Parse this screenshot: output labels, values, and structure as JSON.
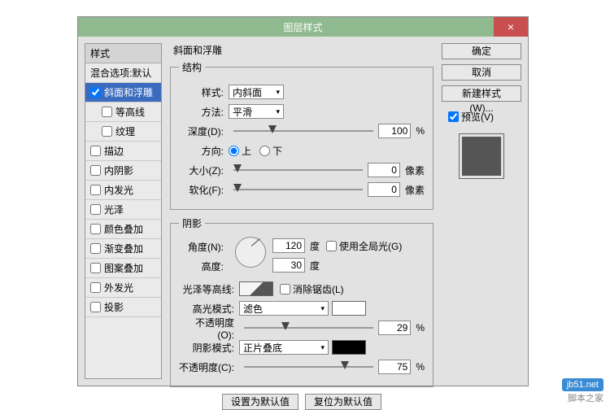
{
  "window": {
    "title": "图层样式",
    "close": "×"
  },
  "left": {
    "header": "样式",
    "blend": "混合选项:默认",
    "items": [
      {
        "label": "斜面和浮雕",
        "checked": true,
        "selected": true
      },
      {
        "label": "等高线",
        "checked": false,
        "indent": true
      },
      {
        "label": "纹理",
        "checked": false,
        "indent": true
      },
      {
        "label": "描边",
        "checked": false
      },
      {
        "label": "内阴影",
        "checked": false
      },
      {
        "label": "内发光",
        "checked": false
      },
      {
        "label": "光泽",
        "checked": false
      },
      {
        "label": "颜色叠加",
        "checked": false
      },
      {
        "label": "渐变叠加",
        "checked": false
      },
      {
        "label": "图案叠加",
        "checked": false
      },
      {
        "label": "外发光",
        "checked": false
      },
      {
        "label": "投影",
        "checked": false
      }
    ]
  },
  "main": {
    "title": "斜面和浮雕",
    "structure": {
      "legend": "结构",
      "styleLabel": "样式:",
      "styleValue": "内斜面",
      "techLabel": "方法:",
      "techValue": "平滑",
      "depthLabel": "深度(D):",
      "depthValue": "100",
      "depthUnit": "%",
      "depthPos": 25,
      "dirLabel": "方向:",
      "dirUp": "上",
      "dirDown": "下",
      "sizeLabel": "大小(Z):",
      "sizeValue": "0",
      "sizeUnit": "像素",
      "sizePos": 0,
      "softLabel": "软化(F):",
      "softValue": "0",
      "softUnit": "像素",
      "softPos": 0
    },
    "shading": {
      "legend": "阴影",
      "angleLabel": "角度(N):",
      "angleValue": "120",
      "angleUnit": "度",
      "globalLabel": "使用全局光(G)",
      "altLabel": "高度:",
      "altValue": "30",
      "altUnit": "度",
      "glossLabel": "光泽等高线:",
      "aaLabel": "消除锯齿(L)",
      "hiModeLabel": "高光模式:",
      "hiModeValue": "滤色",
      "hiOpLabel": "不透明度(O):",
      "hiOpValue": "29",
      "hiOpUnit": "%",
      "hiOpPos": 29,
      "shModeLabel": "阴影模式:",
      "shModeValue": "正片叠底",
      "shOpLabel": "不透明度(C):",
      "shOpValue": "75",
      "shOpUnit": "%",
      "shOpPos": 75
    },
    "buttons": {
      "default": "设置为默认值",
      "reset": "复位为默认值"
    }
  },
  "right": {
    "ok": "确定",
    "cancel": "取消",
    "newStyle": "新建样式(W)...",
    "previewLabel": "预览(V)"
  },
  "footer": {
    "logo": "jb51.net",
    "watermark": "脚本之家"
  }
}
